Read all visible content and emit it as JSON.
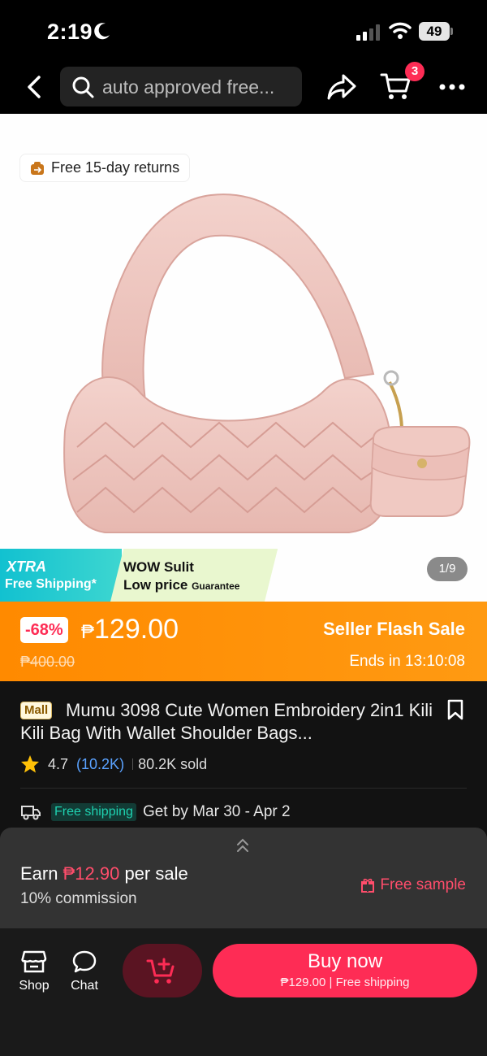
{
  "status_bar": {
    "time": "2:19",
    "battery": "49"
  },
  "nav": {
    "search_placeholder": "auto approved free...",
    "cart_count": "3"
  },
  "gallery": {
    "returns_badge": "Free 15-day returns",
    "promo_xtra": "XTRA",
    "promo_xtra_sub": "Free Shipping*",
    "promo_wow": "WOW Sulit",
    "promo_lowprice": "Low price",
    "promo_guarantee": "Guarantee",
    "image_counter": "1/9"
  },
  "price": {
    "discount": "-68%",
    "currency": "₱",
    "amount": "129.00",
    "original": "₱400.00",
    "flash_label": "Seller Flash Sale",
    "ends_label": "Ends in 13:10:08"
  },
  "product": {
    "mall_badge": "Mall",
    "title": "Mumu 3098 Cute Women Embroidery 2in1 Kili Kili Bag With Wallet Shoulder Bags...",
    "rating": "4.7",
    "reviews": "(10.2K)",
    "sold": "80.2K sold",
    "free_shipping": "Free shipping",
    "delivery": "Get by Mar 30 - Apr 2"
  },
  "earn": {
    "prefix": "Earn ",
    "amount": "₱12.90",
    "suffix": " per sale",
    "commission": "10% commission",
    "free_sample": "Free sample"
  },
  "bottom": {
    "shop_label": "Shop",
    "chat_label": "Chat",
    "buy_label": "Buy now",
    "buy_sub": "₱129.00 | Free shipping"
  },
  "colors": {
    "accent": "#fe2c55",
    "price_band": "#ff8a00",
    "background": "#121212"
  }
}
